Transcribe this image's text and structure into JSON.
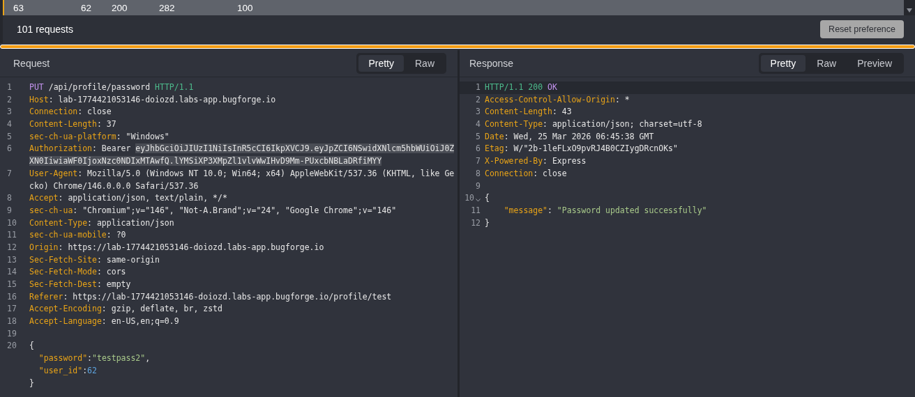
{
  "table_row": {
    "selected": true,
    "cells": [
      "63",
      "62",
      "200",
      "282",
      "100"
    ]
  },
  "request_count": "101 requests",
  "reset_button": "Reset preference",
  "request": {
    "title": "Request",
    "view_tabs": [
      {
        "label": "Pretty",
        "selected": true
      },
      {
        "label": "Raw",
        "selected": false
      }
    ],
    "lines": [
      {
        "number": "1",
        "active": false,
        "tokens": [
          {
            "kind": "method",
            "text": "PUT"
          },
          {
            "kind": "text",
            "text": " /api/profile/password "
          },
          {
            "kind": "proto",
            "text": "HTTP/1.1"
          }
        ]
      },
      {
        "number": "2",
        "active": false,
        "tokens": [
          {
            "kind": "key",
            "text": "Host"
          },
          {
            "kind": "text",
            "text": ": lab-1774421053146-doiozd.labs-app.bugforge.io"
          }
        ]
      },
      {
        "number": "3",
        "active": false,
        "tokens": [
          {
            "kind": "key",
            "text": "Connection"
          },
          {
            "kind": "text",
            "text": ": close"
          }
        ]
      },
      {
        "number": "4",
        "active": false,
        "tokens": [
          {
            "kind": "key",
            "text": "Content-Length"
          },
          {
            "kind": "text",
            "text": ": 37"
          }
        ]
      },
      {
        "number": "5",
        "active": false,
        "tokens": [
          {
            "kind": "key",
            "text": "sec-ch-ua-platform"
          },
          {
            "kind": "text",
            "text": ": \"Windows\""
          }
        ]
      },
      {
        "number": "6",
        "active": false,
        "tokens": [
          {
            "kind": "key",
            "text": "Authorization"
          },
          {
            "kind": "text",
            "text": ": Bearer "
          },
          {
            "kind": "selection",
            "text": "eyJhbGciOiJIUzI1NiIsInR5cCI6IkpXVCJ9.eyJpZCI6NSwidXNlcm5hbWUiOiJ0Z"
          }
        ],
        "continuation": [
          {
            "kind": "selection",
            "text": "XN0IiwiaWF0IjoxNzc0NDIxMTAwfQ.lYMSiXP3XMpZl1vlvWwIHvD9Mm-PUxcbNBLaDRfiMYY"
          }
        ]
      },
      {
        "number": "7",
        "active": false,
        "tokens": [
          {
            "kind": "key",
            "text": "User-Agent"
          },
          {
            "kind": "text",
            "text": ": Mozilla/5.0 (Windows NT 10.0; Win64; x64) AppleWebKit/537.36 (KHTML, like Ge"
          }
        ],
        "continuation": [
          {
            "kind": "text",
            "text": "cko) Chrome/146.0.0.0 Safari/537.36"
          }
        ]
      },
      {
        "number": "8",
        "active": false,
        "tokens": [
          {
            "kind": "key",
            "text": "Accept"
          },
          {
            "kind": "text",
            "text": ": application/json, text/plain, */*"
          }
        ]
      },
      {
        "number": "9",
        "active": false,
        "tokens": [
          {
            "kind": "key",
            "text": "sec-ch-ua"
          },
          {
            "kind": "text",
            "text": ": \"Chromium\";v=\"146\", \"Not-A.Brand\";v=\"24\", \"Google Chrome\";v=\"146\""
          }
        ]
      },
      {
        "number": "10",
        "active": false,
        "tokens": [
          {
            "kind": "key",
            "text": "Content-Type"
          },
          {
            "kind": "text",
            "text": ": application/json"
          }
        ]
      },
      {
        "number": "11",
        "active": false,
        "tokens": [
          {
            "kind": "key",
            "text": "sec-ch-ua-mobile"
          },
          {
            "kind": "text",
            "text": ": ?0"
          }
        ]
      },
      {
        "number": "12",
        "active": false,
        "tokens": [
          {
            "kind": "key",
            "text": "Origin"
          },
          {
            "kind": "text",
            "text": ": https://lab-1774421053146-doiozd.labs-app.bugforge.io"
          }
        ]
      },
      {
        "number": "13",
        "active": false,
        "tokens": [
          {
            "kind": "key",
            "text": "Sec-Fetch-Site"
          },
          {
            "kind": "text",
            "text": ": same-origin"
          }
        ]
      },
      {
        "number": "14",
        "active": false,
        "tokens": [
          {
            "kind": "key",
            "text": "Sec-Fetch-Mode"
          },
          {
            "kind": "text",
            "text": ": cors"
          }
        ]
      },
      {
        "number": "15",
        "active": false,
        "tokens": [
          {
            "kind": "key",
            "text": "Sec-Fetch-Dest"
          },
          {
            "kind": "text",
            "text": ": empty"
          }
        ]
      },
      {
        "number": "16",
        "active": false,
        "tokens": [
          {
            "kind": "key",
            "text": "Referer"
          },
          {
            "kind": "text",
            "text": ": https://lab-1774421053146-doiozd.labs-app.bugforge.io/profile/test"
          }
        ]
      },
      {
        "number": "17",
        "active": false,
        "tokens": [
          {
            "kind": "key",
            "text": "Accept-Encoding"
          },
          {
            "kind": "text",
            "text": ": gzip, deflate, br, zstd"
          }
        ]
      },
      {
        "number": "18",
        "active": false,
        "tokens": [
          {
            "kind": "key",
            "text": "Accept-Language"
          },
          {
            "kind": "text",
            "text": ": en-US,en;q=0.9"
          }
        ]
      },
      {
        "number": "19",
        "active": false
      },
      {
        "number": "20",
        "active": false,
        "tokens": [
          {
            "kind": "text",
            "text": "{"
          }
        ],
        "children": [
          {
            "active": false,
            "tokens": [
              {
                "kind": "json-key",
                "text": "\"password\""
              },
              {
                "kind": "text",
                "text": ":"
              },
              {
                "kind": "string",
                "text": "\"testpass2\""
              },
              {
                "kind": "text",
                "text": ","
              }
            ]
          },
          {
            "active": false,
            "tokens": [
              {
                "kind": "json-key",
                "text": "\"user_id\""
              },
              {
                "kind": "text",
                "text": ":"
              },
              {
                "kind": "number",
                "text": "62"
              }
            ]
          }
        ]
      },
      {
        "active": false,
        "tokens": [
          {
            "kind": "text",
            "text": "}"
          }
        ]
      }
    ]
  },
  "response": {
    "title": "Response",
    "view_tabs": [
      {
        "label": "Pretty",
        "selected": true
      },
      {
        "label": "Raw",
        "selected": false
      },
      {
        "label": "Preview",
        "selected": false
      }
    ],
    "lines": [
      {
        "number": "1",
        "active": true,
        "tokens": [
          {
            "kind": "proto",
            "text": "HTTP/1.1 200 "
          },
          {
            "kind": "method",
            "text": "OK"
          }
        ]
      },
      {
        "number": "2",
        "active": false,
        "tokens": [
          {
            "kind": "key",
            "text": "Access-Control-Allow-Origin"
          },
          {
            "kind": "text",
            "text": ": *"
          }
        ]
      },
      {
        "number": "3",
        "active": false,
        "tokens": [
          {
            "kind": "key",
            "text": "Content-Length"
          },
          {
            "kind": "text",
            "text": ": 43"
          }
        ]
      },
      {
        "number": "4",
        "active": false,
        "tokens": [
          {
            "kind": "key",
            "text": "Content-Type"
          },
          {
            "kind": "text",
            "text": ": application/json; charset=utf-8"
          }
        ]
      },
      {
        "number": "5",
        "active": false,
        "tokens": [
          {
            "kind": "key",
            "text": "Date"
          },
          {
            "kind": "text",
            "text": ": Wed, 25 Mar 2026 06:45:38 GMT"
          }
        ]
      },
      {
        "number": "6",
        "active": false,
        "tokens": [
          {
            "kind": "key",
            "text": "Etag"
          },
          {
            "kind": "text",
            "text": ": W/\"2b-1leFLxO9pvRJ4B0CZIygDRcnOKs\""
          }
        ]
      },
      {
        "number": "7",
        "active": false,
        "tokens": [
          {
            "kind": "key",
            "text": "X-Powered-By"
          },
          {
            "kind": "text",
            "text": ": Express"
          }
        ]
      },
      {
        "number": "8",
        "active": false,
        "tokens": [
          {
            "kind": "key",
            "text": "Connection"
          },
          {
            "kind": "text",
            "text": ": close"
          }
        ]
      },
      {
        "number": "9",
        "active": false
      },
      {
        "number": "10",
        "active": false,
        "expanded": true,
        "tokens": [
          {
            "kind": "text",
            "text": "{"
          }
        ],
        "children": [
          {
            "number": "11",
            "active": false,
            "tokens": [
              {
                "kind": "json-key",
                "text": "\"message\""
              },
              {
                "kind": "text",
                "text": ": "
              },
              {
                "kind": "string",
                "text": "\"Password updated successfully\""
              }
            ]
          }
        ]
      },
      {
        "number": "12",
        "active": false,
        "tokens": [
          {
            "kind": "text",
            "text": "}"
          }
        ]
      }
    ]
  }
}
